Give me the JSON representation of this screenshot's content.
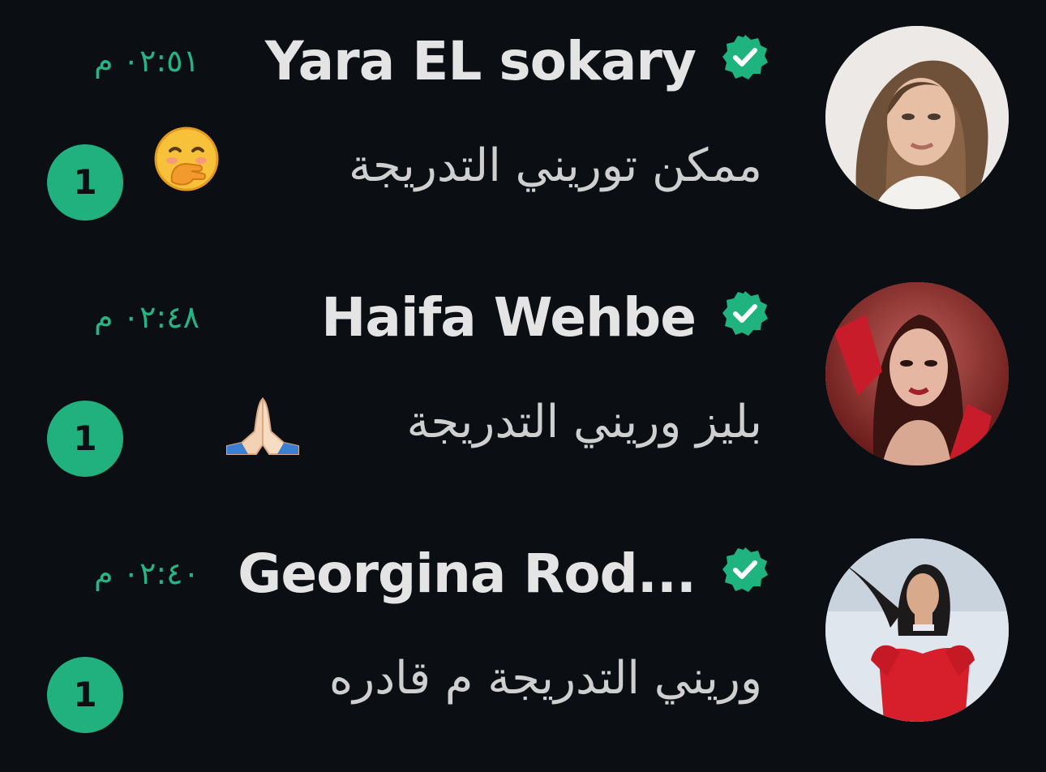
{
  "colors": {
    "background": "#0b0e12",
    "accent": "#21b17f",
    "time_text": "#25b585",
    "name_text": "#e4e4e4",
    "preview_text": "#cfcfcf"
  },
  "chats": [
    {
      "name": "Yara EL sokary",
      "verified": true,
      "time": "٠٢:٥١ م",
      "preview": "ممكن توريني التدريجة",
      "emoji": "face-with-hand-over-mouth",
      "unread": "1",
      "avatar": "woman-light-hair-avatar"
    },
    {
      "name": "Haifa Wehbe",
      "verified": true,
      "time": "٠٢:٤٨ م",
      "preview": "بليز وريني التدريجة",
      "emoji": "folded-hands",
      "unread": "1",
      "avatar": "woman-red-gloves-avatar"
    },
    {
      "name": "Georgina Rod...",
      "verified": true,
      "time": "٠٢:٤٠ م",
      "preview": "وريني التدريجة م قادره",
      "emoji": "",
      "unread": "1",
      "avatar": "woman-red-dress-avatar"
    }
  ]
}
